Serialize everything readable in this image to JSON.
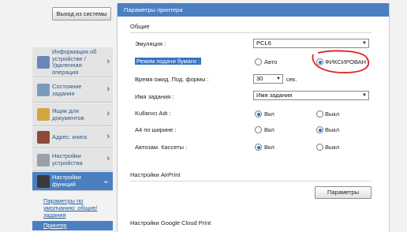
{
  "sidebar": {
    "logout_label": "Выход из системы",
    "items": [
      {
        "label": "Информация об устройстве / Удаленная операция",
        "icon": "device-info-icon"
      },
      {
        "label": "Состояние задания",
        "icon": "job-status-icon"
      },
      {
        "label": "Ящик для документов",
        "icon": "document-box-icon"
      },
      {
        "label": "Адрес. книга",
        "icon": "address-book-icon"
      },
      {
        "label": "Настройки устройства",
        "icon": "device-settings-icon"
      },
      {
        "label": "Настройки функций",
        "icon": "function-settings-icon"
      }
    ],
    "sub_items": [
      "Параметры по умолчанию: общие/задания",
      "Принтер"
    ]
  },
  "main": {
    "title": "Параметры принтера",
    "section_general": "Общие",
    "fields": {
      "emulation_label": "Эмуляция :",
      "emulation_value": "PCL6",
      "paper_feed_label": "Режим подачи бумаги :",
      "paper_feed_auto": "Авто",
      "paper_feed_fixed": "ФИКСИРОВАН",
      "form_feed_label": "Время ожид. Под. формы :",
      "form_feed_value": "30",
      "form_feed_unit": "сек.",
      "job_name_label": "Имя задания :",
      "job_name_value": "Имя задания",
      "user_name_label": "Kullanıcı Adı :",
      "user_on": "Вкл",
      "user_off": "Выкл",
      "a4_label": "А4 по ширине :",
      "a4_on": "Вкл",
      "a4_off": "Выкл",
      "autocassette_label": "Автозам. Кассеты :",
      "autocassette_on": "Вкл",
      "autocassette_off": "Выкл"
    },
    "section_airprint": "Настройки AirPrint",
    "airprint_button": "Параметры",
    "section_gcp": "Настройки Google Cloud Print"
  },
  "colors": {
    "accent": "#4a7fc1",
    "radio_selected": "#1e6fd9",
    "annotation": "#e02020"
  }
}
